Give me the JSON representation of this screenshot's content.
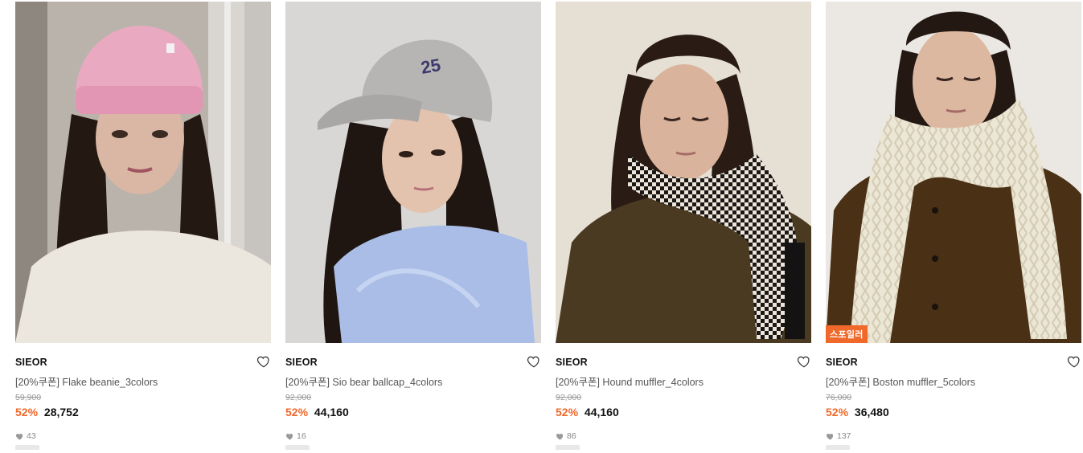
{
  "products": [
    {
      "brand": "SIEOR",
      "title": "[20%쿠폰] Flake beanie_3colors",
      "original_price": "59,900",
      "discount": "52%",
      "price": "28,752",
      "likes": "43",
      "badge": "",
      "image": "woman-pink-knit-beanie-photo"
    },
    {
      "brand": "SIEOR",
      "title": "[20%쿠폰] Sio bear ballcap_4colors",
      "original_price": "92,000",
      "discount": "52%",
      "price": "44,160",
      "likes": "16",
      "badge": "",
      "image": "woman-grey-ballcap-photo"
    },
    {
      "brand": "SIEOR",
      "title": "[20%쿠폰] Hound muffler_4colors",
      "original_price": "92,000",
      "discount": "52%",
      "price": "44,160",
      "likes": "86",
      "badge": "",
      "image": "woman-houndstooth-muffler-photo"
    },
    {
      "brand": "SIEOR",
      "title": "[20%쿠폰] Boston muffler_5colors",
      "original_price": "76,000",
      "discount": "52%",
      "price": "36,480",
      "likes": "137",
      "badge": "스포일러",
      "image": "woman-cream-cable-muffler-photo"
    }
  ],
  "colors": {
    "discount": "#f0682a",
    "badge": "#f0682a",
    "heart": "#333333"
  }
}
